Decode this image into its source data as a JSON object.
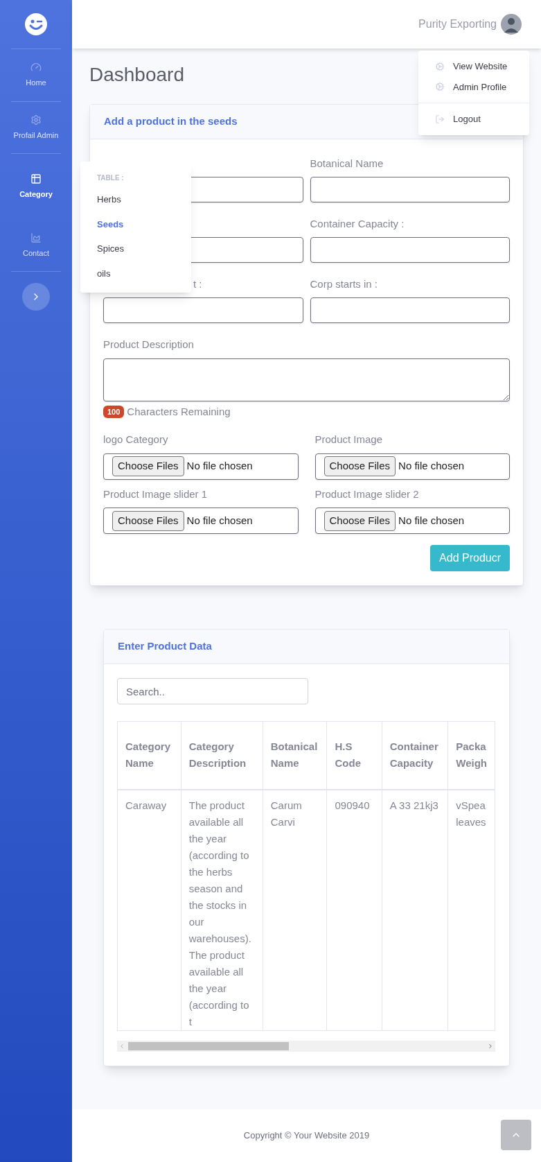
{
  "sidebar": {
    "items": [
      {
        "label": "Home",
        "kind": "gauge",
        "selected": false
      },
      {
        "label": "Profail Admin",
        "kind": "gear",
        "selected": false
      },
      {
        "label": "Category",
        "kind": "table",
        "selected": true
      },
      {
        "label": "Contact",
        "kind": "chart",
        "selected": false
      }
    ]
  },
  "category_menu": {
    "heading": "TABLE :",
    "items": [
      {
        "label": "Herbs",
        "selected": false
      },
      {
        "label": "Seeds",
        "selected": true
      },
      {
        "label": "Spices",
        "selected": false
      },
      {
        "label": "oils",
        "selected": false
      }
    ]
  },
  "header": {
    "user": "Purity Exporting"
  },
  "user_menu": {
    "items": [
      {
        "label": "View Website",
        "kind": "cogs"
      },
      {
        "label": "Admin Profile",
        "kind": "cogs"
      },
      {
        "label": "Logout",
        "kind": "logout"
      }
    ]
  },
  "title": "Dashboard",
  "product_form": {
    "title": "Add a product in the seeds",
    "rows": [
      {
        "left": "",
        "right": "Botanical Name"
      },
      {
        "left": "",
        "right": "Container Capacity :"
      },
      {
        "left": "t :",
        "right": "Corp starts in :"
      }
    ],
    "description_label": "Product Description",
    "counter": "100",
    "counter_text": "Characters Remaining",
    "files": [
      {
        "label": "logo Category",
        "button": "Choose Files",
        "status": "No file chosen"
      },
      {
        "label": "Product Image",
        "button": "Choose Files",
        "status": "No file chosen"
      },
      {
        "label": "Product Image slider 1",
        "button": "Choose Files",
        "status": "No file chosen"
      },
      {
        "label": "Product Image slider 2",
        "button": "Choose Files",
        "status": "No file chosen"
      }
    ],
    "submit": "Add Producr"
  },
  "data_card": {
    "title": "Enter Product Data",
    "search": {
      "placeholder": "Search.."
    },
    "table": {
      "columns": [
        "Category Name",
        "Category Description",
        "Botanical Name",
        "H.S Code",
        "Container Capacity",
        "Packa Weigh"
      ],
      "rows": [
        [
          "Caraway",
          "The product available all the year (according to the herbs season and the stocks in our warehouses). The product available all the year (according to t",
          "Carum Carvi",
          "090940",
          "A 33 21kj3",
          "vSpea leaves"
        ]
      ]
    }
  },
  "footer": {
    "copyright": "Copyright © Your Website 2019"
  }
}
